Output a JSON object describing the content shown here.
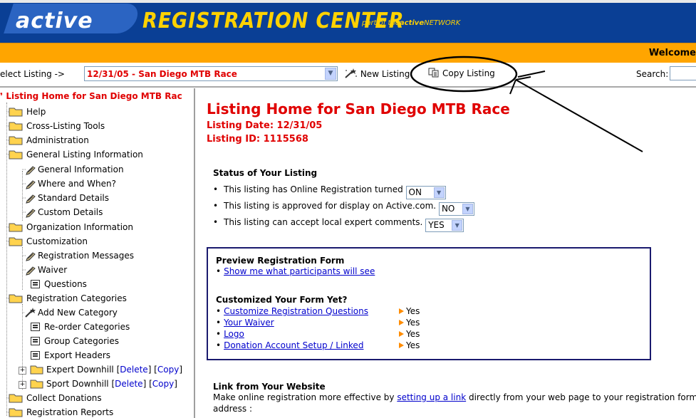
{
  "header": {
    "logo": "active",
    "product": "REGISTRATION CENTER",
    "part_of_prefix": "part of the",
    "part_of_brand": "active",
    "part_of_suffix": "NETWORK",
    "welcome": "Welcome"
  },
  "toolbar": {
    "select_label": "elect Listing ->",
    "selected_listing": "12/31/05 - San Diego MTB Race",
    "new_listing": "New Listing",
    "copy_listing": "Copy Listing",
    "search_label": "Search:",
    "search_value": ""
  },
  "sidebar": {
    "top": "Listing Home for San Diego MTB Rac",
    "help": "Help",
    "cross_listing": "Cross-Listing Tools",
    "administration": "Administration",
    "general": "General Listing Information",
    "general_info": "General Information",
    "where_when": "Where and When?",
    "standard_details": "Standard Details",
    "custom_details": "Custom Details",
    "organization": "Organization Information",
    "customization": "Customization",
    "reg_messages": "Registration Messages",
    "waiver": "Waiver",
    "questions": "Questions",
    "reg_categories": "Registration Categories",
    "add_category": "Add New Category",
    "reorder": "Re-order Categories",
    "group": "Group Categories",
    "export_headers": "Export Headers",
    "expert_downhill": "Expert Downhill",
    "sport_downhill": "Sport Downhill",
    "delete": "Delete",
    "copy": "Copy",
    "collect_donations": "Collect Donations",
    "reg_reports": "Registration Reports"
  },
  "main": {
    "title": "Listing Home for San Diego MTB Race",
    "listing_date": "Listing Date: 12/31/05",
    "listing_id": "Listing ID: 1115568",
    "status_title": "Status of Your Listing",
    "status_online": "This listing has Online Registration turned",
    "status_online_value": "ON",
    "status_approved": "This listing is approved for display on Active.com.",
    "status_approved_value": "NO",
    "status_comments": "This listing can accept local expert comments.",
    "status_comments_value": "YES",
    "preview_title": "Preview Registration Form",
    "preview_link": "Show me what participants will see",
    "custom_title": "Customized Your Form Yet?",
    "custom_items": [
      {
        "label": "Customize Registration Questions",
        "status": "Yes"
      },
      {
        "label": "Your Waiver",
        "status": "Yes"
      },
      {
        "label": "Logo",
        "status": "Yes"
      },
      {
        "label": "Donation Account Setup / Linked",
        "status": "Yes"
      }
    ],
    "link_title": "Link from Your Website",
    "link_text_pre": "Make online registration more effective by",
    "link_text_link": "setting up a link",
    "link_text_post": "directly from your web page to your registration form!.",
    "address": "address :"
  },
  "colors": {
    "banner": "#0a3f95",
    "orange_bar": "#ffa500",
    "red_text": "#e00000",
    "link": "#0000cc"
  }
}
